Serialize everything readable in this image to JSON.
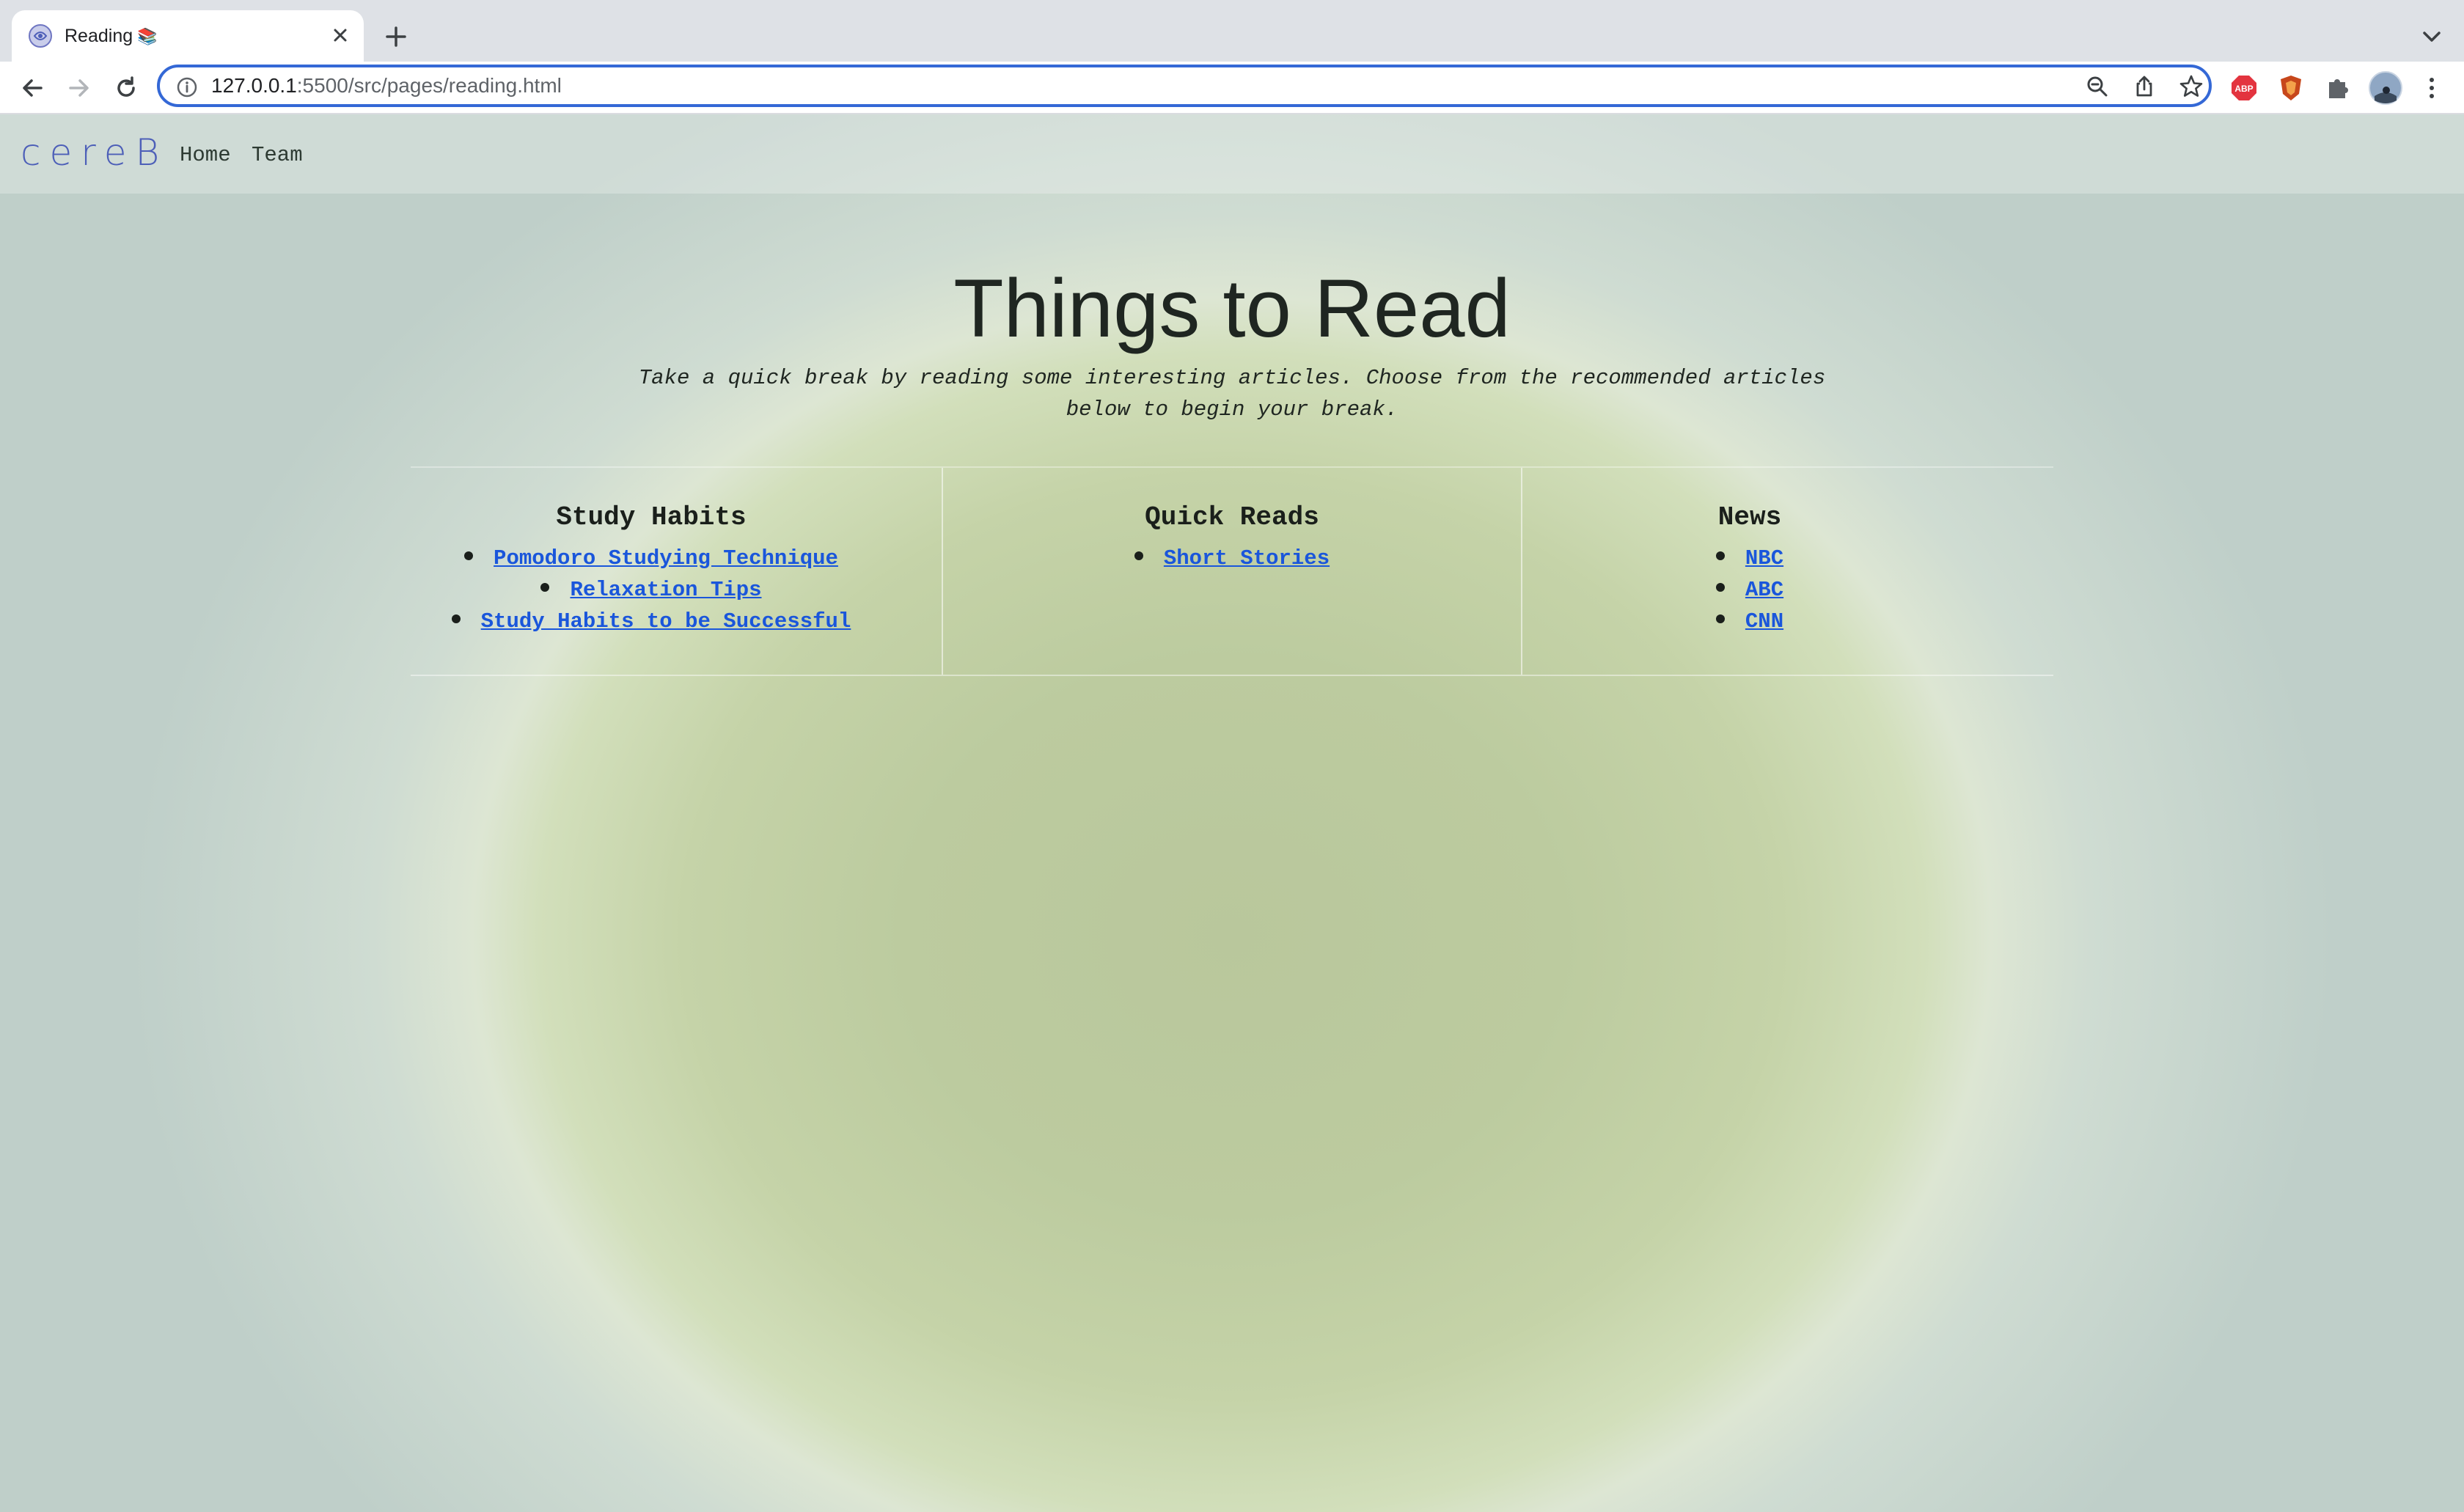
{
  "browser": {
    "tab": {
      "title": "Reading",
      "emoji": "📚"
    },
    "address": {
      "host": "127.0.0.1",
      "path": ":5500/src/pages/reading.html"
    },
    "accent_color": "#3468d6"
  },
  "site": {
    "logo": "cereB",
    "nav": {
      "home": "Home",
      "team": "Team"
    }
  },
  "page": {
    "title": "Things to Read",
    "subtitle_line1": "Take a quick break by reading some interesting articles. Choose from the recommended articles",
    "subtitle_line2": "below to begin your break."
  },
  "columns": [
    {
      "title": "Study Habits",
      "links": [
        "Pomodoro Studying Technique",
        "Relaxation Tips",
        "Study Habits to be Successful"
      ]
    },
    {
      "title": "Quick Reads",
      "links": [
        "Short Stories"
      ]
    },
    {
      "title": "News",
      "links": [
        "NBC",
        "ABC",
        "CNN"
      ]
    }
  ],
  "colors": {
    "link": "#1a56db",
    "logo": "#4d5fb8",
    "text": "#1f2621"
  }
}
